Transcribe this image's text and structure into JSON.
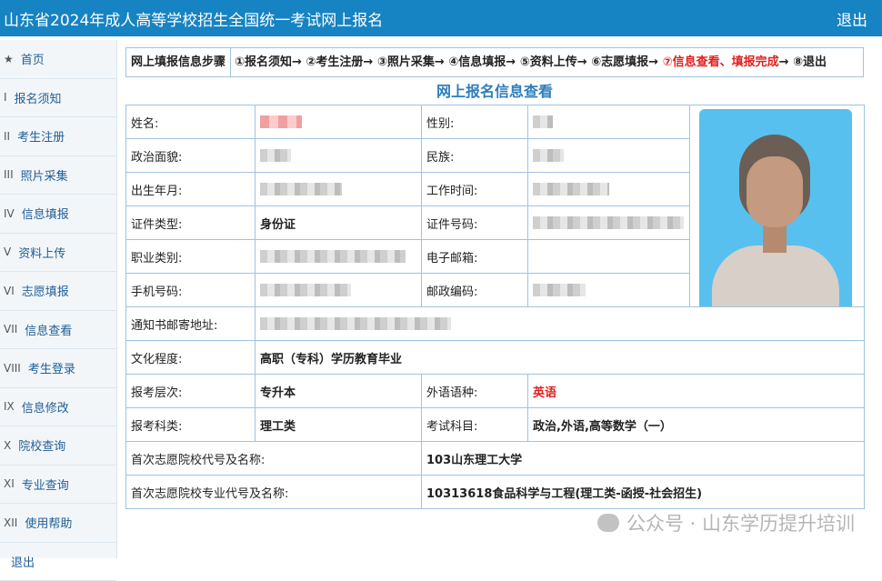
{
  "header": {
    "title": "山东省2024年成人高等学校招生全国统一考试网上报名",
    "logout": "退出"
  },
  "sidebar": {
    "items": [
      {
        "num": "★",
        "label": "首页"
      },
      {
        "num": "I",
        "label": "报名须知"
      },
      {
        "num": "II",
        "label": "考生注册"
      },
      {
        "num": "III",
        "label": "照片采集"
      },
      {
        "num": "IV",
        "label": "信息填报"
      },
      {
        "num": "V",
        "label": "资料上传"
      },
      {
        "num": "VI",
        "label": "志愿填报"
      },
      {
        "num": "VII",
        "label": "信息查看"
      },
      {
        "num": "VIII",
        "label": "考生登录"
      },
      {
        "num": "IX",
        "label": "信息修改"
      },
      {
        "num": "X",
        "label": "院校查询"
      },
      {
        "num": "XI",
        "label": "专业查询"
      },
      {
        "num": "XII",
        "label": "使用帮助"
      },
      {
        "num": "",
        "label": "退出"
      }
    ]
  },
  "steps": {
    "label": "网上填报信息步骤",
    "flow_normal": "①报名须知→ ②考生注册→ ③照片采集→ ④信息填报→ ⑤资料上传→ ⑥志愿填报→ ",
    "flow_highlight": "⑦信息查看、填报完成",
    "flow_tail": "→ ⑧退出"
  },
  "section_title": "网上报名信息查看",
  "info": {
    "name_label": "姓名:",
    "gender_label": "性别:",
    "political_label": "政治面貌:",
    "ethnic_label": "民族:",
    "birth_label": "出生年月:",
    "worktime_label": "工作时间:",
    "idtype_label": "证件类型:",
    "idtype_value": "身份证",
    "idnum_label": "证件号码:",
    "job_label": "职业类别:",
    "email_label": "电子邮箱:",
    "phone_label": "手机号码:",
    "postcode_label": "邮政编码:",
    "address_label": "通知书邮寄地址:",
    "education_label": "文化程度:",
    "education_value": "高职（专科）学历教育毕业",
    "level_label": "报考层次:",
    "level_value": "专升本",
    "language_label": "外语语种:",
    "language_value": "英语",
    "category_label": "报考科类:",
    "category_value": "理工类",
    "subjects_label": "考试科目:",
    "subjects_value": "政治,外语,高等数学（一）",
    "school_label": "首次志愿院校代号及名称:",
    "school_value": "103山东理工大学",
    "major_label": "首次志愿院校专业代号及名称:",
    "major_value": "10313618食品科学与工程(理工类-函授-社会招生)"
  },
  "watermark": "公众号 · 山东学历提升培训"
}
